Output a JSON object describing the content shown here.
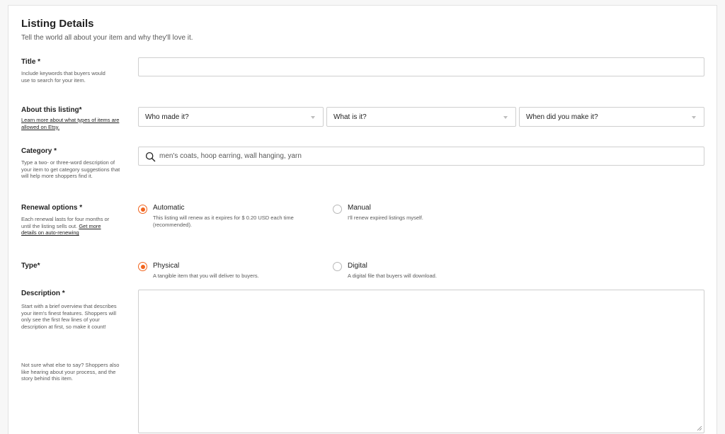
{
  "section": {
    "title": "Listing Details",
    "subtitle": "Tell the world all about your item and why they'll love it."
  },
  "title_field": {
    "label": "Title *",
    "help": "Include keywords that buyers would use to search for your item.",
    "value": ""
  },
  "about": {
    "label": "About this listing*",
    "help_link": "Learn more about what types of items are allowed on Etsy.",
    "selects": [
      {
        "value": "Who made it?"
      },
      {
        "value": "What is it?"
      },
      {
        "value": "When did you make it?"
      }
    ]
  },
  "category": {
    "label": "Category *",
    "help": "Type a two- or three-word description of your item to get category suggestions that will help more shoppers find it.",
    "placeholder": "men's coats, hoop earring, wall hanging, yarn",
    "icon": "search-icon"
  },
  "renewal": {
    "label": "Renewal options *",
    "help_text": "Each renewal lasts for four months or until the listing sells out.",
    "help_link": "Get more details on auto-renewing",
    "options": [
      {
        "label": "Automatic",
        "desc": "This listing will renew as it expires for $ 0.20 USD each time (recommended).",
        "selected": true
      },
      {
        "label": "Manual",
        "desc": "I'll renew expired listings myself.",
        "selected": false
      }
    ]
  },
  "type": {
    "label": "Type*",
    "options": [
      {
        "label": "Physical",
        "desc": "A tangible item that you will deliver to buyers.",
        "selected": true
      },
      {
        "label": "Digital",
        "desc": "A digital file that buyers will download.",
        "selected": false
      }
    ]
  },
  "description": {
    "label": "Description *",
    "help_1": "Start with a brief overview that describes your item's finest features. Shoppers will only see the first few lines of your description at first, so make it count!",
    "help_2": "Not sure what else to say? Shoppers also like hearing about your process, and the story behind this item.",
    "value": ""
  },
  "colors": {
    "accent": "#f1641e",
    "border": "#cfcfcf",
    "text": "#222222",
    "muted": "#595959"
  }
}
